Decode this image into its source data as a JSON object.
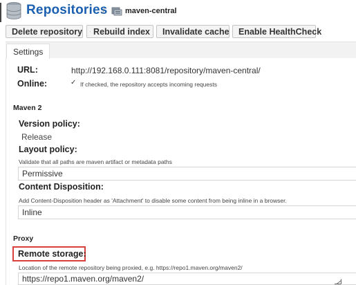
{
  "header": {
    "title": "Repositories",
    "separator": "/",
    "repo_name": "maven-central",
    "accent_color": "#1b5fb0"
  },
  "toolbar": {
    "delete_label": "Delete repository",
    "rebuild_label": "Rebuild index",
    "invalidate_label": "Invalidate cache",
    "healthcheck_label": "Enable HealthCheck"
  },
  "tabs": {
    "settings_label": "Settings"
  },
  "settings": {
    "url_label": "URL:",
    "url_value": "http://192.168.0.111:8081/repository/maven-central/",
    "online_label": "Online:",
    "online_checked": true,
    "online_help": "If checked, the repository accepts incoming requests",
    "maven_section": "Maven 2",
    "version_policy_label": "Version policy:",
    "version_policy_value": "Release",
    "layout_policy_label": "Layout policy:",
    "layout_policy_help": "Validate that all paths are maven artifact or metadata paths",
    "layout_policy_value": "Permissive",
    "content_disposition_label": "Content Disposition:",
    "content_disposition_help": "Add Content-Disposition header as 'Attachment' to disable some content from being inline in a browser.",
    "content_disposition_value": "Inline",
    "proxy_section": "Proxy",
    "remote_storage_label": "Remote storage:",
    "remote_storage_help": "Location of the remote repository being proxied, e.g. https://repo1.maven.org/maven2/",
    "remote_storage_value": "https://repo1.maven.org/maven2/",
    "highlight_color": "#d9403b"
  }
}
